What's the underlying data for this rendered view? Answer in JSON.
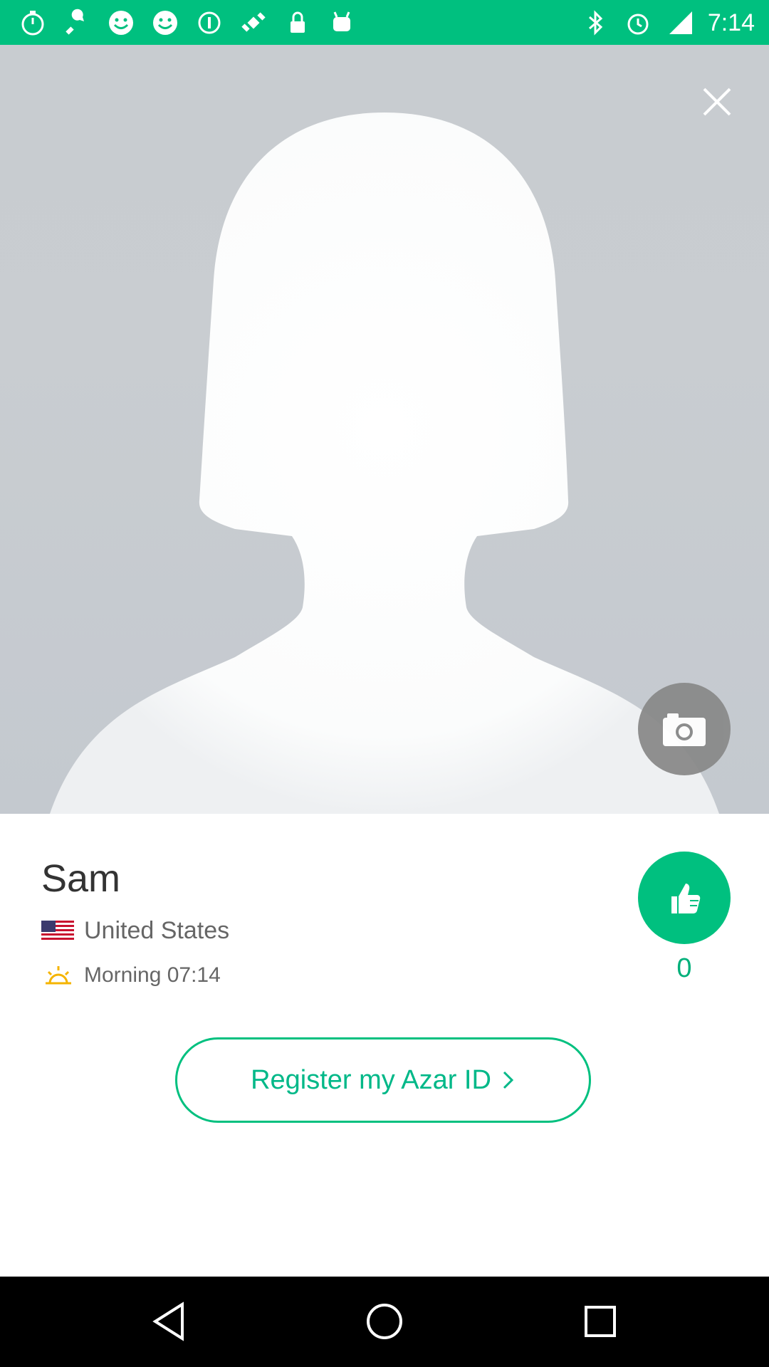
{
  "status_bar": {
    "time": "7:14",
    "left_icons": [
      "timer-icon",
      "wrench-icon",
      "smiley-icon",
      "smiley-icon",
      "info-icon",
      "satellite-icon",
      "lock-icon",
      "android-icon"
    ],
    "right_icons": [
      "bluetooth-icon",
      "alarm-icon",
      "signal-icon"
    ],
    "color": "#00c07f"
  },
  "profile": {
    "name": "Sam",
    "country": "United States",
    "local_time": "Morning 07:14",
    "likes": "0"
  },
  "actions": {
    "register_label": "Register my Azar ID"
  },
  "colors": {
    "accent": "#00c07f",
    "photo_bg": "#c8ccd0",
    "camera_bg": "#8a8a8a"
  }
}
